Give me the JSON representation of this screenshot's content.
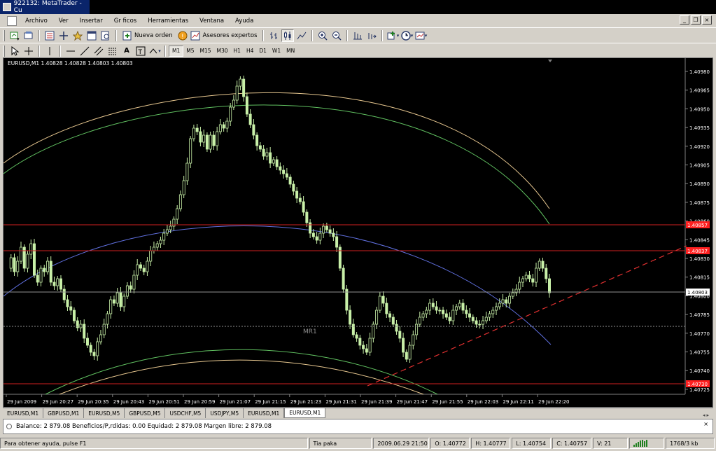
{
  "window": {
    "title": "922132: MetaTrader - Cu"
  },
  "menu": [
    "Archivo",
    "Ver",
    "Insertar",
    "Gr ficos",
    "Herramientas",
    "Ventana",
    "Ayuda"
  ],
  "toolbar": {
    "new_order_label": "Nueva orden",
    "expert_advisors_label": "Asesores expertos"
  },
  "timeframes": [
    "M1",
    "M5",
    "M15",
    "M30",
    "H1",
    "H4",
    "D1",
    "W1",
    "MN"
  ],
  "active_timeframe": "M1",
  "chart": {
    "info": "EURUSD,M1  1.40828 1.40828 1.40803 1.40803",
    "label_mr1": "MR1",
    "price_axis": [
      "1.40980",
      "1.40965",
      "1.40950",
      "1.40935",
      "1.40920",
      "1.40905",
      "1.40890",
      "1.40875",
      "1.40860",
      "1.40845",
      "1.40830",
      "1.40815",
      "1.40800",
      "1.40785",
      "1.40770",
      "1.40755",
      "1.40740",
      "1.40725"
    ],
    "time_axis": [
      "29 Jun 2009",
      "29 Jun 20:27",
      "29 Jun 20:35",
      "29 Jun 20:43",
      "29 Jun 20:51",
      "29 Jun 20:59",
      "29 Jun 21:07",
      "29 Jun 21:15",
      "29 Jun 21:23",
      "29 Jun 21:31",
      "29 Jun 21:39",
      "29 Jun 21:47",
      "29 Jun 21:55",
      "29 Jun 22:03",
      "29 Jun 22:11",
      "29 Jun 22:20"
    ],
    "price_tags": [
      {
        "value": "1.40857",
        "color": "#ff2020"
      },
      {
        "value": "1.40837",
        "color": "#ff2020"
      },
      {
        "value": "1.40803",
        "color": "#ffffff"
      },
      {
        "value": "1.40730",
        "color": "#ff2020"
      }
    ],
    "colors": {
      "bull": "#c8f0a8",
      "bear": "#c8f0a8",
      "outer_arc": "#e8c890",
      "green_arc": "#60c060",
      "blue_arc": "#6070e0",
      "level": "#ff2020",
      "trend": "#e03030"
    }
  },
  "tabs": [
    "EURUSD,M1",
    "GBPUSD,M1",
    "EURUSD,M5",
    "GBPUSD,M5",
    "USDCHF,M5",
    "USDJPY,M5",
    "EURUSD,M1",
    "EURUSD,M1"
  ],
  "active_tab": 7,
  "terminal": {
    "text": "Balance: 2 879.08  Beneficios/P,rdidas: 0.00  Equidad: 2 879.08  Margen libre: 2 879.08"
  },
  "status": {
    "help": "Para obtener ayuda, pulse F1",
    "profile": "Tia paka",
    "datetime": "2009.06.29 21:50",
    "open": "O: 1.40772",
    "high": "H: 1.40777",
    "low": "L: 1.40754",
    "close": "C: 1.40757",
    "volume": "V: 21",
    "traffic": "1768/3 kb"
  }
}
